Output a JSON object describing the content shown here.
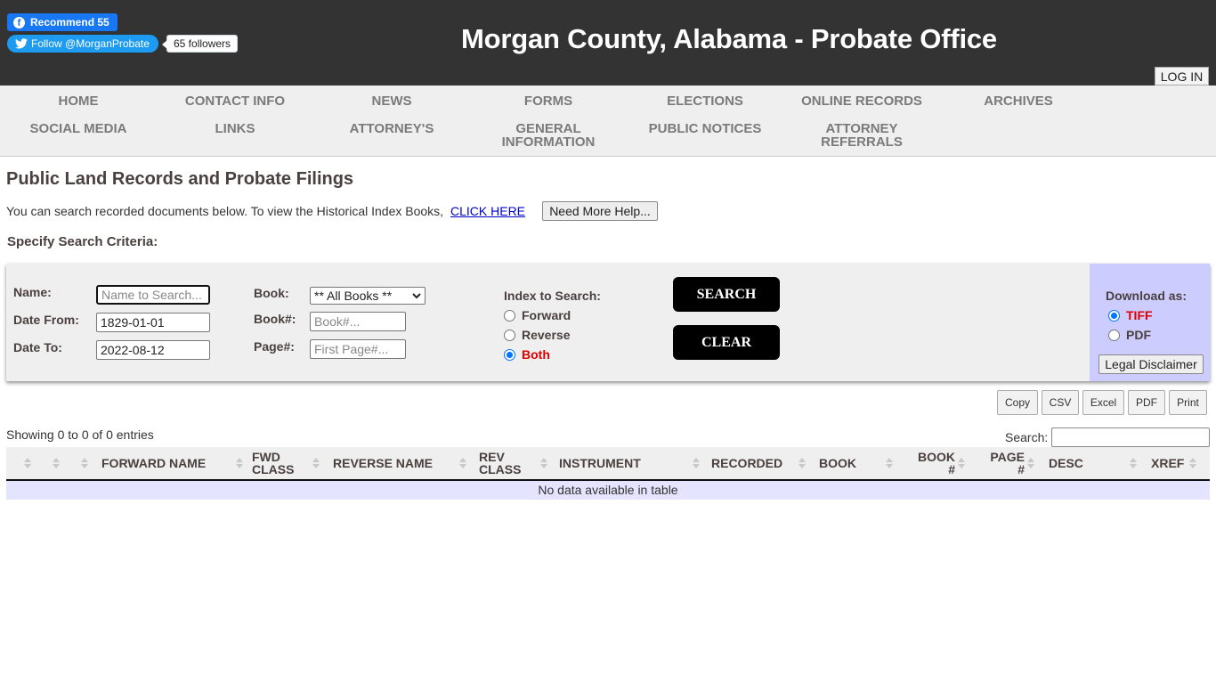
{
  "header": {
    "facebook": {
      "label": "Recommend 55"
    },
    "twitter": {
      "label": "Follow @MorganProbate",
      "followers": "65 followers"
    },
    "title": "Morgan County, Alabama - Probate Office",
    "login_label": "LOG IN"
  },
  "nav": {
    "items": [
      {
        "label": "HOME"
      },
      {
        "label": "CONTACT INFO"
      },
      {
        "label": "NEWS"
      },
      {
        "label": "FORMS"
      },
      {
        "label": "ELECTIONS"
      },
      {
        "label": "ONLINE RECORDS"
      },
      {
        "label": "ARCHIVES"
      },
      {
        "label": "SOCIAL MEDIA"
      },
      {
        "label": "LINKS"
      },
      {
        "label": "ATTORNEY'S"
      },
      {
        "label": "GENERAL INFORMATION"
      },
      {
        "label": "PUBLIC NOTICES"
      },
      {
        "label": "ATTORNEY REFERRALS"
      }
    ]
  },
  "main": {
    "title": "Public Land Records and Probate Filings",
    "intro": "You can search recorded documents below. To view the Historical Index Books,",
    "click_here": "CLICK HERE",
    "help_label": "Need More Help...",
    "criteria_title": "Specify Search Criteria:"
  },
  "search": {
    "name_label": "Name:",
    "name_placeholder": "Name to Search...",
    "date_from_label": "Date From:",
    "date_from": "1829-01-01",
    "date_to_label": "Date To:",
    "date_to": "2022-08-12",
    "book_label": "Book:",
    "book_selected": "** All Books **",
    "book_num_label": "Book#:",
    "book_num_placeholder": "Book#...",
    "page_num_label": "Page#:",
    "page_num_placeholder": "First Page#...",
    "index_label": "Index to Search:",
    "index_options": [
      {
        "label": "Forward",
        "checked": false
      },
      {
        "label": "Reverse",
        "checked": false
      },
      {
        "label": "Both",
        "checked": true
      }
    ],
    "search_label": "SEARCH",
    "clear_label": "CLEAR",
    "download_label": "Download as:",
    "download_options": [
      {
        "label": "TIFF",
        "checked": true
      },
      {
        "label": "PDF",
        "checked": false
      }
    ],
    "legal_label": "Legal Disclaimer"
  },
  "table_controls": {
    "export_buttons": [
      "Copy",
      "CSV",
      "Excel",
      "PDF",
      "Print"
    ],
    "showing": "Showing 0 to 0 of 0 entries",
    "search_label": "Search:"
  },
  "table": {
    "columns": [
      {
        "label": ""
      },
      {
        "label": ""
      },
      {
        "label": ""
      },
      {
        "label": "FORWARD NAME"
      },
      {
        "label": "FWD CLASS"
      },
      {
        "label": "REVERSE NAME"
      },
      {
        "label": "REV CLASS"
      },
      {
        "label": "INSTRUMENT"
      },
      {
        "label": "RECORDED"
      },
      {
        "label": "BOOK"
      },
      {
        "label": "BOOK #"
      },
      {
        "label": "PAGE #"
      },
      {
        "label": "DESC"
      },
      {
        "label": "XREF"
      }
    ],
    "empty_message": "No data available in table"
  },
  "colors": {
    "header_bg": "#333333",
    "nav_bg": "#efefef",
    "download_bg": "#ccccff",
    "empty_row_bg": "#e4e4ff",
    "accent_red": "#e00000",
    "radio_blue": "#0075ff"
  }
}
